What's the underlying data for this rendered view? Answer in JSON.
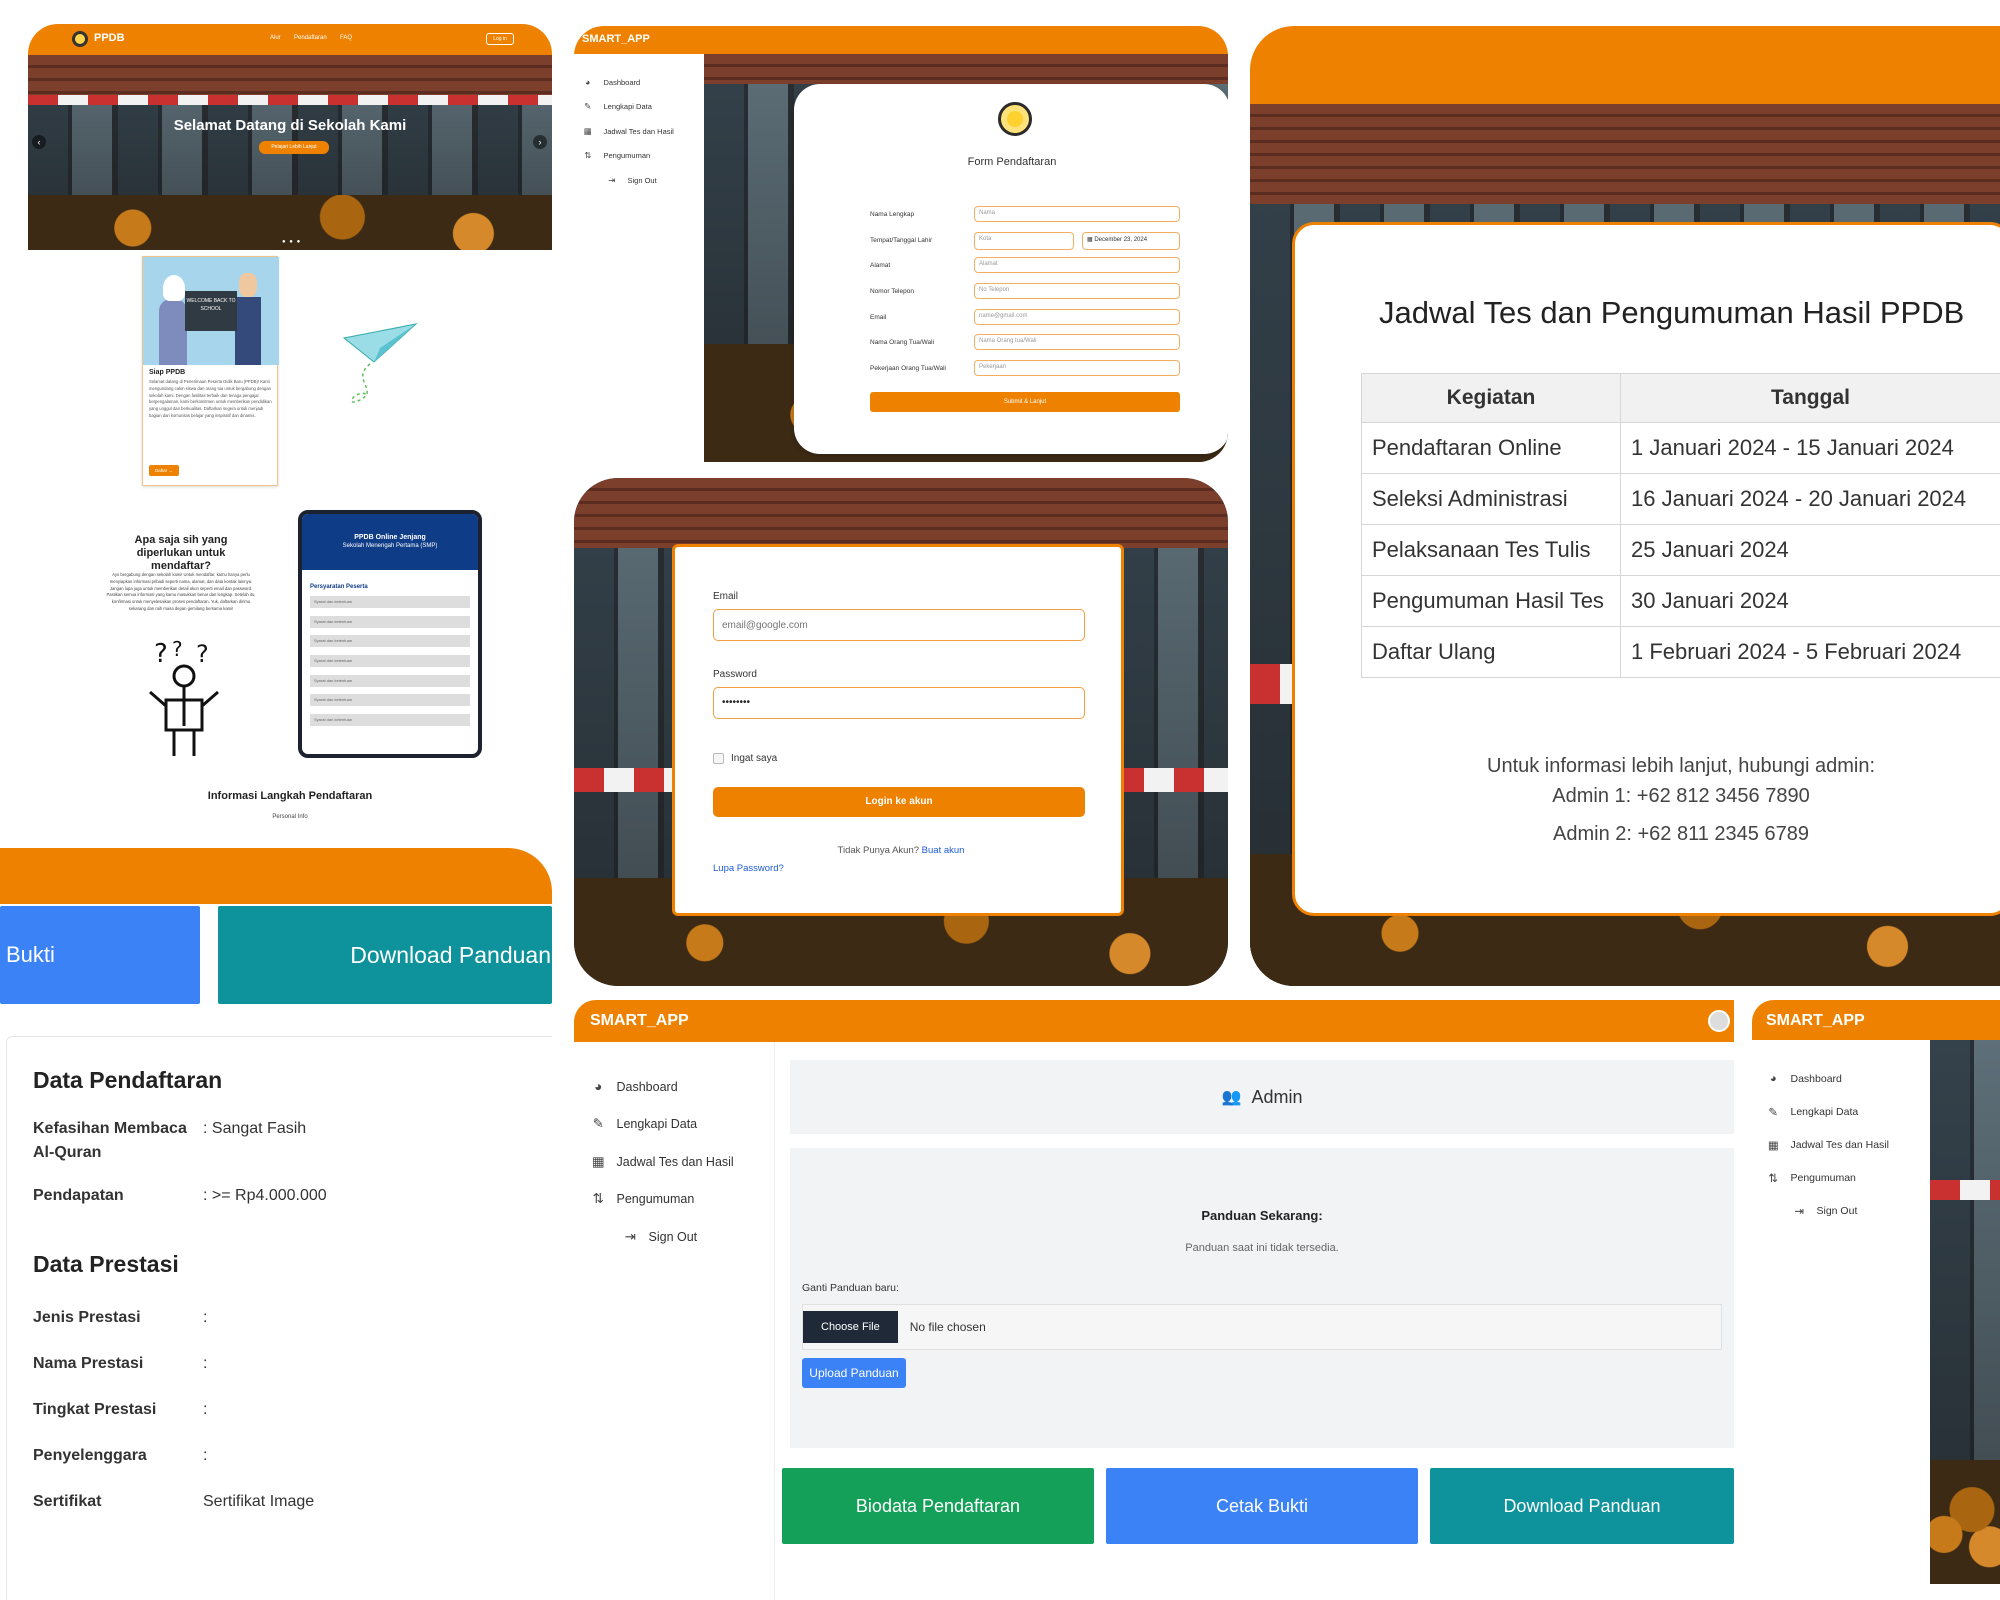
{
  "ppdb": {
    "logo_text": "PPDB",
    "nav": [
      "Alur",
      "Pendaftaran",
      "FAQ"
    ],
    "login": "Log in",
    "hero_title": "Selamat Datang di Sekolah Kami",
    "hero_button": "Pelajari Lebih Lanjut",
    "card_title": "Siap PPDB",
    "card_text": "Selamat datang di Penerimaan Peserta Didik Baru (PPDB)! Kami mengundang calon siswa dan orang tua untuk bergabung dengan sekolah kami. Dengan fasilitas terbaik dan tenaga pengajar berpengalaman, kami berkomitmen untuk memberikan pendidikan yang unggul dan berkualitas. Daftarkan segera untuk menjadi bagian dari komunitas belajar yang inspiratif dan dinamis.",
    "card_button": "Daftar",
    "board_text": "WELCOME BACK TO SCHOOL",
    "req_title": "Apa saja sih yang diperlukan untuk mendaftar?",
    "req_text": "Ayo bergabung dengan sekolah kami! Untuk mendaftar, kamu hanya perlu menyiapkan informasi pribadi seperti nama, alamat, dan data kontak lainnya. Jangan lupa juga untuk memberikan detail akun seperti email dan password. Pastikan semua informasi yang kamu masukkan benar dan lengkap. Setelah itu, konfirmasi untuk menyelesaikan proses pendaftaran. Yuk, daftarkan dirimu sekarang dan raih masa depan gemilang bersama kami!",
    "phone_title": "PPDB Online Jenjang",
    "phone_sub": "Sekolah Menengah Pertama (SMP)",
    "phone_section": "Persyaratan Peserta",
    "phone_items": [
      "Syarat dan ketentuan",
      "Syarat dan ketentuan",
      "Syarat dan ketentuan",
      "Syarat dan ketentuan",
      "Syarat dan ketentuan",
      "Syarat dan ketentuan",
      "Syarat dan ketentuan"
    ],
    "steps_title": "Informasi Langkah Pendaftaran",
    "steps_first": "Personal Info"
  },
  "form": {
    "brand": "SMART_APP",
    "sidebar": [
      "Dashboard",
      "Lengkapi Data",
      "Jadwal Tes dan Hasil",
      "Pengumuman",
      "Sign Out"
    ],
    "title": "Form Pendaftaran",
    "labels": [
      "Nama Lengkap",
      "Tempat/Tanggal Lahir",
      "Alamat",
      "Nomor Telepon",
      "Email",
      "Nama Orang Tua/Wali",
      "Pekerjaan Orang Tua/Wali"
    ],
    "placeholders": [
      "Nama",
      "Kota",
      "Alamat",
      "No Telepon",
      "name@gmail.com",
      "Nama Orang tua/Wali",
      "Pekerjaan"
    ],
    "date_value": "December 23, 2024",
    "submit": "Submit & Lanjut"
  },
  "login": {
    "email_label": "Email",
    "email_placeholder": "email@google.com",
    "password_label": "Password",
    "password_value": "••••••••",
    "remember": "Ingat saya",
    "button": "Login ke akun",
    "no_account": "Tidak Punya Akun?",
    "register": "Buat akun",
    "forgot": "Lupa Password?"
  },
  "jadwal": {
    "title": "Jadwal Tes dan Pengumuman Hasil PPDB",
    "headers": [
      "Kegiatan",
      "Tanggal"
    ],
    "rows": [
      [
        "Pendaftaran Online",
        "1 Januari 2024 - 15 Januari 2024"
      ],
      [
        "Seleksi Administrasi",
        "16 Januari 2024 - 20 Januari 2024"
      ],
      [
        "Pelaksanaan Tes Tulis",
        "25 Januari 2024"
      ],
      [
        "Pengumuman Hasil Tes",
        "30 Januari 2024"
      ],
      [
        "Daftar Ulang",
        "1 Februari 2024 - 5 Februari 2024"
      ]
    ],
    "contact_intro": "Untuk informasi lebih lanjut, hubungi admin:",
    "admin1": "Admin 1: +62 812 3456 7890",
    "admin2": "Admin 2: +62 811 2345 6789"
  },
  "biodata": {
    "btn_left": "Bukti",
    "btn_right": "Download Panduan",
    "section1": "Data Pendaftaran",
    "rows1": [
      [
        "Kefasihan Membaca Al-Quran",
        ": Sangat Fasih"
      ],
      [
        "Pendapatan",
        ": >= Rp4.000.000"
      ]
    ],
    "section2": "Data Prestasi",
    "rows2": [
      [
        "Jenis Prestasi",
        ":"
      ],
      [
        "Nama Prestasi",
        ":"
      ],
      [
        "Tingkat Prestasi",
        ":"
      ],
      [
        "Penyelenggara",
        ":"
      ],
      [
        "Sertifikat",
        "Sertifikat Image"
      ]
    ]
  },
  "admin": {
    "brand": "SMART_APP",
    "sidebar": [
      "Dashboard",
      "Lengkapi Data",
      "Jadwal Tes dan Hasil",
      "Pengumuman",
      "Sign Out"
    ],
    "header": "Admin",
    "panduan_title": "Panduan Sekarang:",
    "panduan_text": "Panduan saat ini tidak tersedia.",
    "ganti_label": "Ganti Panduan baru:",
    "choose_file": "Choose File",
    "no_file": "No file chosen",
    "upload": "Upload Panduan",
    "buttons": [
      "Biodata Pendaftaran",
      "Cetak Bukti",
      "Download Panduan"
    ],
    "colors": {
      "green": "#15a05a",
      "blue": "#3b82f6",
      "teal": "#0e939c"
    }
  },
  "side": {
    "brand": "SMART_APP",
    "sidebar": [
      "Dashboard",
      "Lengkapi Data",
      "Jadwal Tes dan Hasil",
      "Pengumuman",
      "Sign Out"
    ]
  }
}
